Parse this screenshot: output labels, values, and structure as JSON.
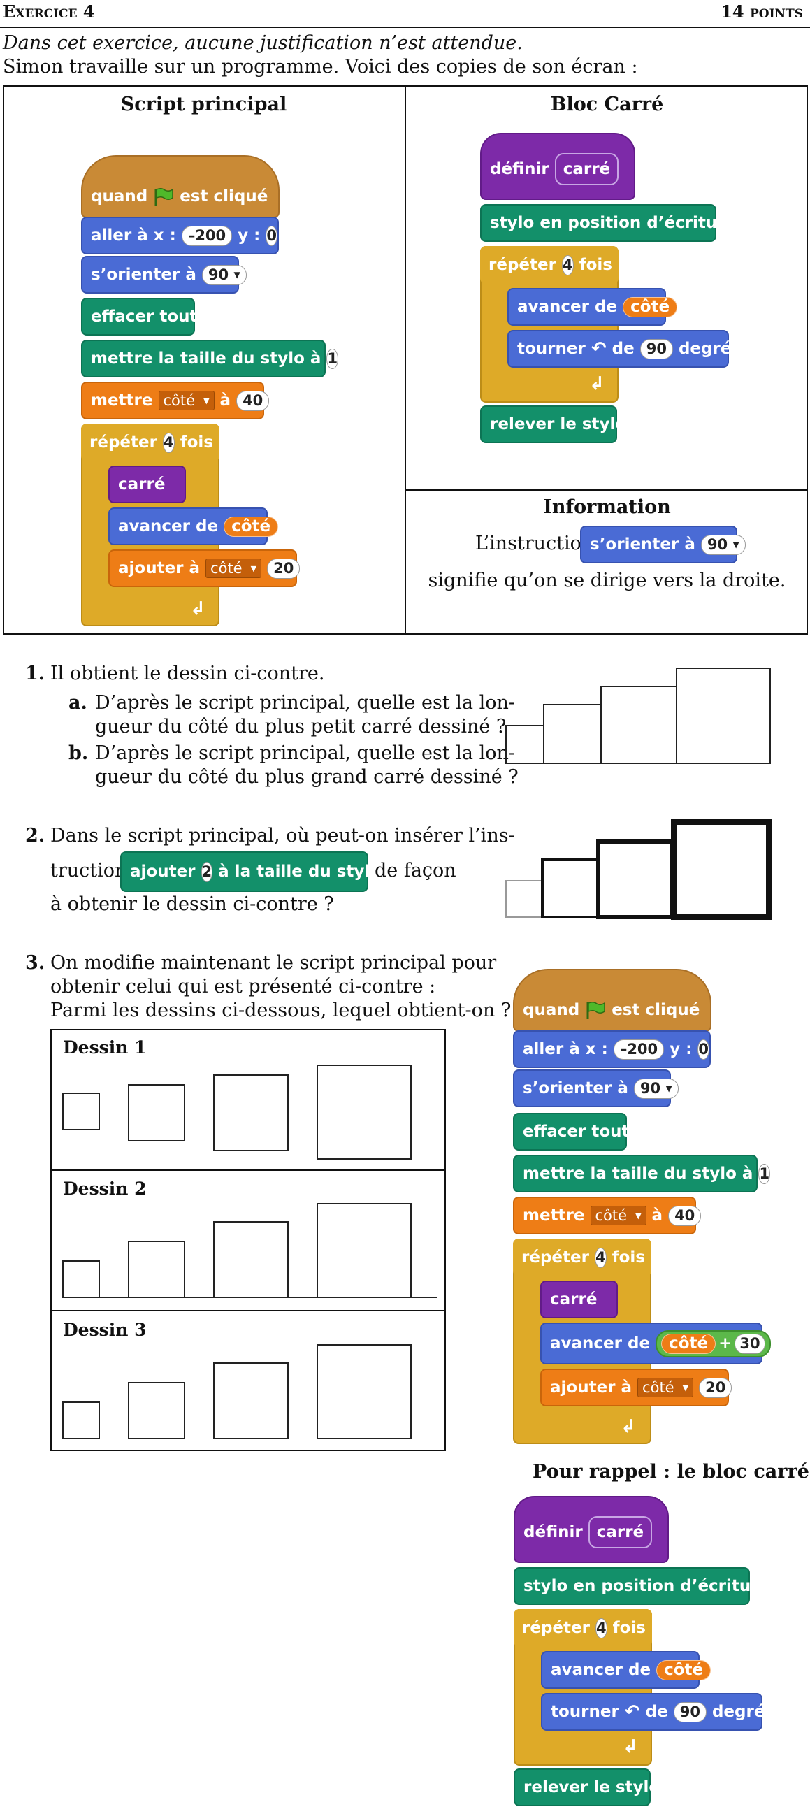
{
  "header": {
    "exercise": "Exercice 4",
    "points": "14 points"
  },
  "intro": {
    "line1": "Dans cet exercice, aucune justification n’est attendue.",
    "line2": "Simon travaille sur un programme. Voici des copies de son écran :"
  },
  "panels": {
    "script_principal_title": "Script principal",
    "bloc_carre_title": "Bloc Carré",
    "information_title": "Information",
    "info_prefix": "L’instruction",
    "info_suffix": "signifie qu’on se dirige vers la droite."
  },
  "blocks": {
    "quand": "quand",
    "est_clique": "est cliqué",
    "aller_a_x": "aller à x :",
    "x_val": "–200",
    "y_label": "y :",
    "y_val": "0",
    "orienter": "s’orienter à",
    "orient_val": "90",
    "effacer": "effacer tout",
    "taille_stylo": "mettre la taille du stylo à",
    "taille_val": "1",
    "mettre": "mettre",
    "var_cote": "côté",
    "a": "à",
    "mettre_val": "40",
    "repeter": "répéter",
    "repeter_val": "4",
    "fois": "fois",
    "carre": "carré",
    "avancer_de": "avancer de",
    "ajouter_a": "ajouter à",
    "ajouter_val": "20",
    "definir": "définir",
    "stylo_ecriture": "stylo en position d’écriture",
    "tourner": "tourner",
    "de": "de",
    "tourner_val": "90",
    "degres": "degrés",
    "relever": "relever le stylo",
    "plus": "+",
    "plus_val": "30",
    "ajouter2": "ajouter",
    "ajouter2_val": "2",
    "taille_du_stylo": "à la taille du stylo"
  },
  "q1": {
    "num": "1.",
    "text": "Il obtient le dessin ci-contre.",
    "a_label": "a.",
    "a_l1": "D’après le script principal, quelle est la lon-",
    "a_l2": "gueur du côté du plus petit carré dessiné ?",
    "b_label": "b.",
    "b_l1": "D’après le script principal, quelle est la lon-",
    "b_l2": "gueur du côté du plus grand carré dessiné ?"
  },
  "q2": {
    "num": "2.",
    "l1": "Dans le script principal, où peut-on insérer l’ins-",
    "l2a": "truction",
    "l2b": "de façon",
    "l3": "à obtenir le dessin ci-contre ?"
  },
  "q3": {
    "num": "3.",
    "l1": "On modifie maintenant le script principal pour",
    "l2": "obtenir celui qui est présenté ci-contre :",
    "l3": "Parmi les dessins ci-dessous, lequel obtient-on ?",
    "dessin1": "Dessin 1",
    "dessin2": "Dessin 2",
    "dessin3": "Dessin 3",
    "rappel": "Pour rappel : le bloc carré"
  }
}
